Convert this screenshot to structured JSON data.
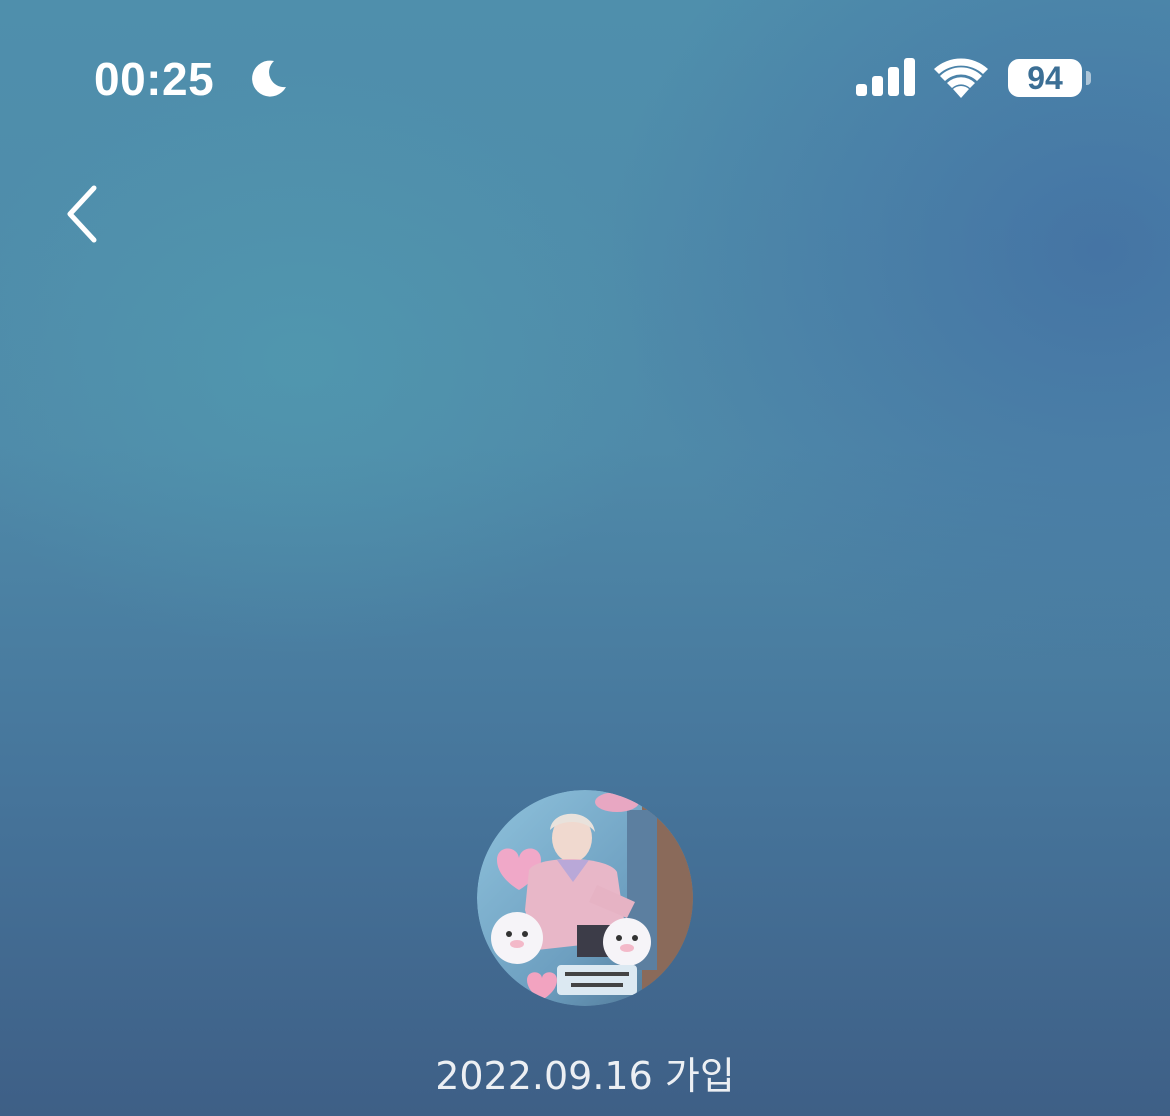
{
  "status_bar": {
    "time": "00:25",
    "focus_icon": "moon-icon",
    "signal_icon": "cellular-signal-icon",
    "wifi_icon": "wifi-icon",
    "battery_level": "94"
  },
  "nav": {
    "back_icon": "chevron-left-icon"
  },
  "profile": {
    "avatar": "profile-photo",
    "join_text": "2022.09.16 가입"
  },
  "colors": {
    "background_top": "#4f8fac",
    "background_bottom": "#3e5f86",
    "battery_text": "#3c6f95"
  }
}
